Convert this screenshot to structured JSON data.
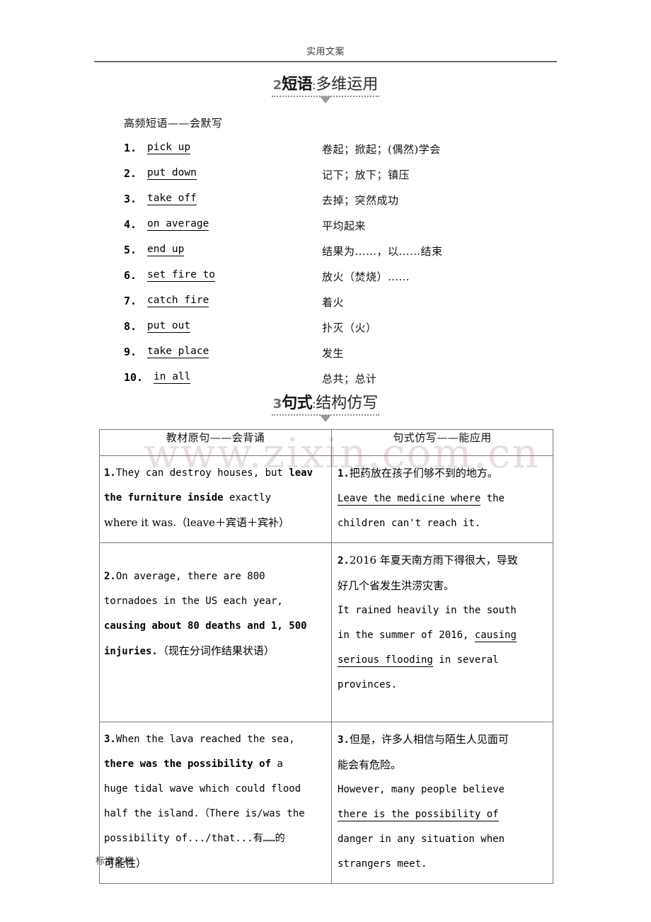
{
  "header": {
    "text": "实用文案"
  },
  "footer": {
    "text": "标准文档"
  },
  "watermark": {
    "text": "www.zixin.com.cn"
  },
  "section_phrases": {
    "number": "2",
    "keyword": "短语",
    "colon": ":",
    "subtitle": "多维运用",
    "subhead": "高频短语——会默写",
    "items": [
      {
        "num": "1.",
        "en": "pick up",
        "cn": "卷起；掀起；(偶然)学会"
      },
      {
        "num": "2.",
        "en": "put down",
        "cn": "记下；放下；镇压"
      },
      {
        "num": "3.",
        "en": "take off",
        "cn": "去掉；突然成功"
      },
      {
        "num": "4.",
        "en": "on average",
        "cn": "平均起来"
      },
      {
        "num": "5.",
        "en": "end up",
        "cn": "结果为……，以……结束"
      },
      {
        "num": "6.",
        "en": "set fire to",
        "cn": "放火（焚烧）……"
      },
      {
        "num": "7.",
        "en": "catch fire",
        "cn": "着火"
      },
      {
        "num": "8.",
        "en": "put out",
        "cn": "扑灭（火）"
      },
      {
        "num": "9.",
        "en": "take place",
        "cn": "发生"
      },
      {
        "num": "10.",
        "en": "in all",
        "cn": "总共；总计"
      }
    ]
  },
  "section_sentences": {
    "number": "3",
    "keyword": "句式",
    "colon": ":",
    "subtitle": "结构仿写",
    "table": {
      "headers": [
        "教材原句——会背诵",
        "句式仿写——能应用"
      ],
      "rows": [
        {
          "left": {
            "index": "1.",
            "l1_a": "They can destroy houses, but ",
            "l1_b": "leav",
            "l2_a": "the furniture inside",
            "l2_b": " exactly",
            "l3": "where it was.（leave＋宾语＋宾补）"
          },
          "right": {
            "index": "1.",
            "l1": "把药放在孩子们够不到的地方。",
            "l2_a": "Leave the medicine where",
            "l2_b": " the",
            "l3": "children can't reach it."
          }
        },
        {
          "left": {
            "index": "2.",
            "l1": "On average, there are 800",
            "l2": "tornadoes in the US each year,",
            "l3": "causing about 80 deaths and 1, 500",
            "l4_a": "injuries.",
            "l4_b": "（现在分词作结果状语）"
          },
          "right": {
            "index": "2.",
            "l1": "2016 年夏天南方雨下得很大，导致",
            "l2": "好几个省发生洪涝灾害。",
            "l3": "It rained heavily in the south",
            "l4_a": "in the summer of 2016, ",
            "l4_b": "causing ",
            "l5_a": "serious flooding",
            "l5_b": " in several",
            "l6": "provinces."
          }
        },
        {
          "left": {
            "index": "3.",
            "l1": "When the lava reached the sea,",
            "l2_a": "there was the possibility of",
            "l2_b": " a",
            "l3": "huge tidal wave which could flood",
            "l4": "half the island.（There is/was the",
            "l5": "possibility of.../that...有……的",
            "l6": "可能性）"
          },
          "right": {
            "index": "3.",
            "l1": "但是，许多人相信与陌生人见面可",
            "l2": "能会有危险。",
            "l3": "However, many people believe",
            "l4": "there is the possibility of ",
            "l5": "danger in any situation when",
            "l6": "strangers meet."
          }
        }
      ]
    }
  }
}
